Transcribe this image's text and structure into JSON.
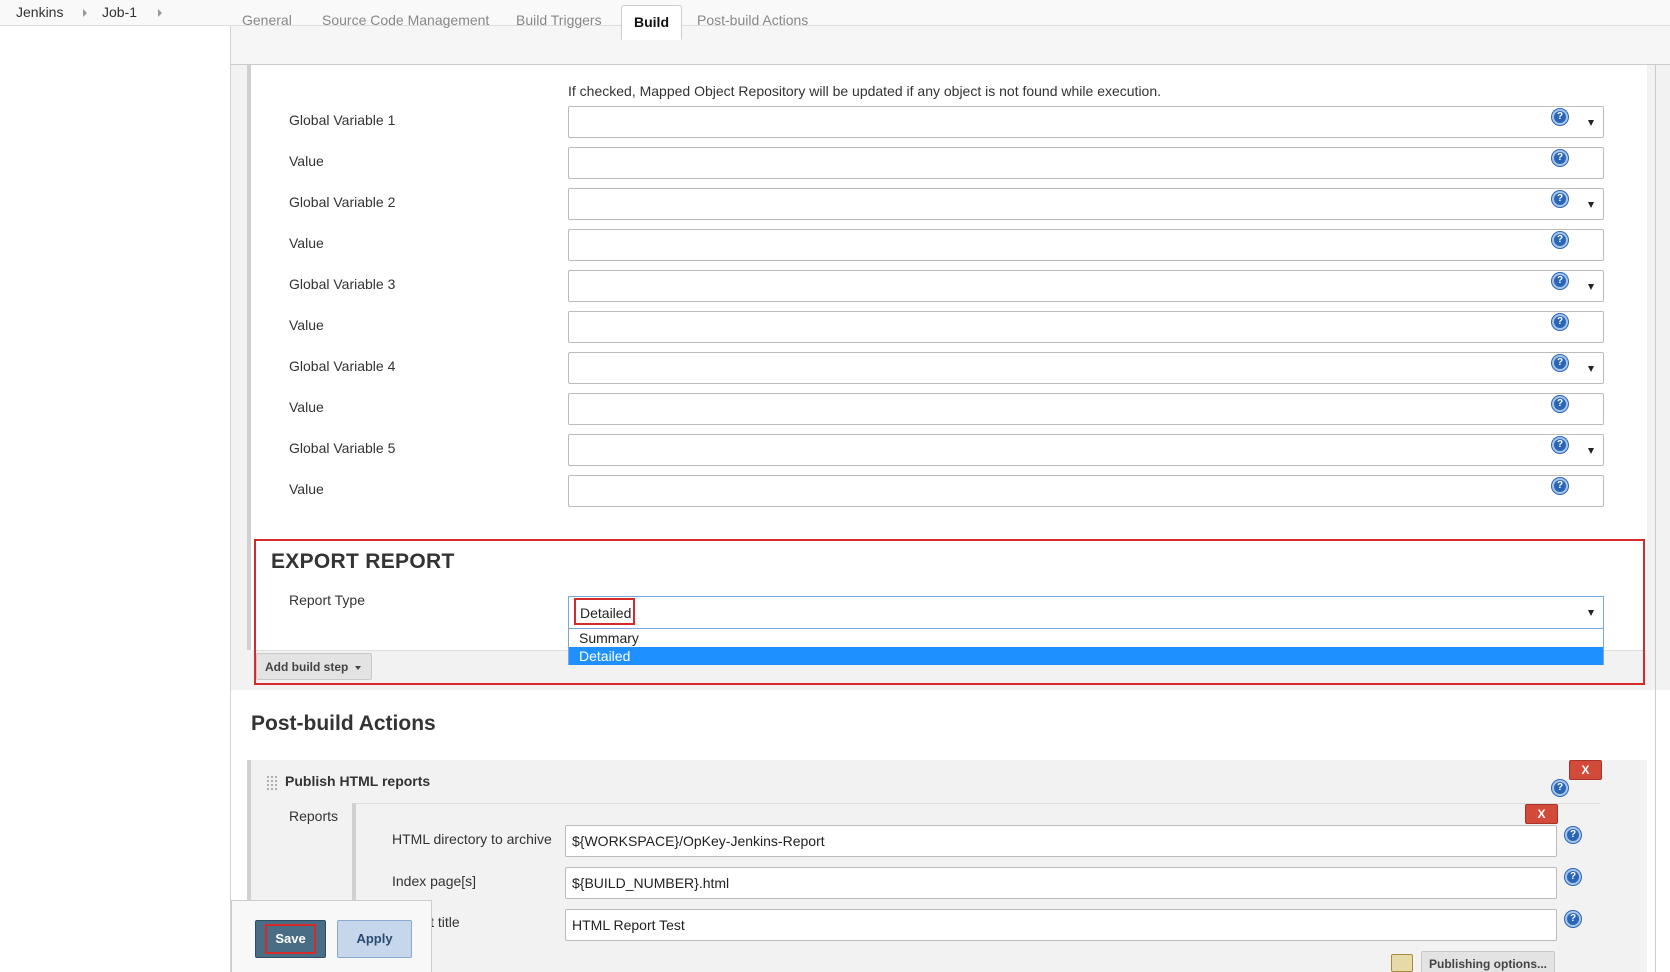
{
  "breadcrumb": {
    "items": [
      "Jenkins",
      "Job-1"
    ]
  },
  "tabs": [
    "General",
    "Source Code Management",
    "Build Triggers",
    "Build",
    "Post-build Actions"
  ],
  "build": {
    "help_text": "If checked, Mapped Object Repository will be updated if any object is not found while execution.",
    "fields": [
      {
        "label": "Global Variable 1",
        "type": "select",
        "value": ""
      },
      {
        "label": "Value",
        "type": "text",
        "value": ""
      },
      {
        "label": "Global Variable 2",
        "type": "select",
        "value": ""
      },
      {
        "label": "Value",
        "type": "text",
        "value": ""
      },
      {
        "label": "Global Variable 3",
        "type": "select",
        "value": ""
      },
      {
        "label": "Value",
        "type": "text",
        "value": ""
      },
      {
        "label": "Global Variable 4",
        "type": "select",
        "value": ""
      },
      {
        "label": "Value",
        "type": "text",
        "value": ""
      },
      {
        "label": "Global Variable 5",
        "type": "select",
        "value": ""
      },
      {
        "label": "Value",
        "type": "text",
        "value": ""
      }
    ],
    "export_title": "EXPORT REPORT",
    "report_type_label": "Report Type",
    "report_type_value": "Detailed",
    "report_type_options": [
      "Summary",
      "Detailed"
    ],
    "add_build_step": "Add build step"
  },
  "post_build": {
    "title": "Post-build Actions",
    "publish_title": "Publish HTML reports",
    "delete_label": "X",
    "reports_label": "Reports",
    "rows": [
      {
        "label": "HTML directory to archive",
        "value": "${WORKSPACE}/OpKey-Jenkins-Report"
      },
      {
        "label": "Index page[s]",
        "value": "${BUILD_NUMBER}.html"
      },
      {
        "label": "Report title",
        "value": "HTML Report Test"
      }
    ],
    "publishing_options": "Publishing options..."
  },
  "actions": {
    "save": "Save",
    "apply": "Apply"
  },
  "icons": {
    "help": "?",
    "help_icon_name": "help-icon"
  },
  "colors": {
    "highlight": "#d42a2a",
    "selected_option": "#1e90ff",
    "save_button": "#4a6d86",
    "help_icon": "#2a66b5"
  }
}
